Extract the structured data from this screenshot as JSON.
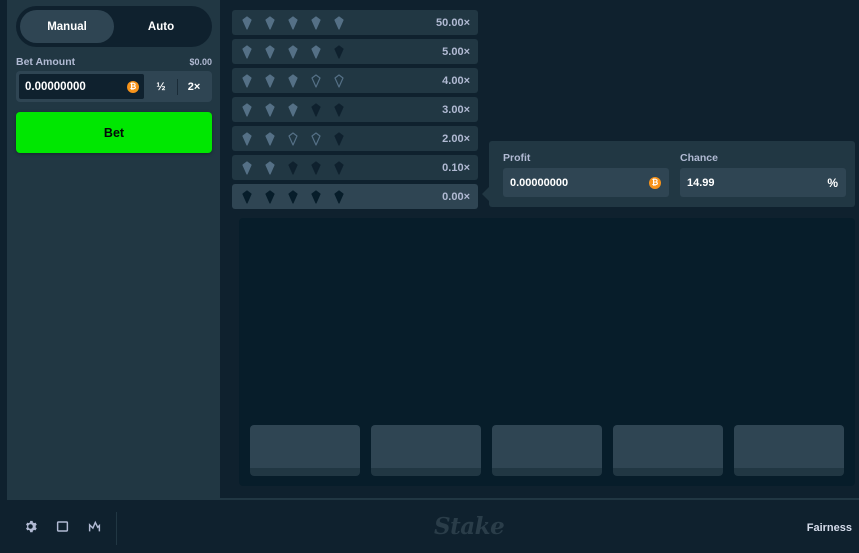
{
  "sidebar": {
    "modes": [
      {
        "label": "Manual",
        "active": true
      },
      {
        "label": "Auto",
        "active": false
      }
    ],
    "bet_amount_label": "Bet Amount",
    "bet_amount_usd": "$0.00",
    "bet_amount_value": "0.00000000",
    "currency_icon": "bitcoin-icon",
    "half_label": "½",
    "double_label": "2×",
    "bet_button_label": "Bet"
  },
  "payout_table": [
    {
      "gems_lit": 5,
      "multiplier": "50.00×",
      "active": false
    },
    {
      "gems_lit": 4,
      "multiplier": "5.00×",
      "active": false
    },
    {
      "gems_lit": 3,
      "multiplier": "4.00×",
      "active": false
    },
    {
      "gems_lit": 3,
      "multiplier": "3.00×",
      "active": false
    },
    {
      "gems_lit": 2,
      "multiplier": "2.00×",
      "active": false
    },
    {
      "gems_lit": 2,
      "multiplier": "0.10×",
      "active": false
    },
    {
      "gems_lit": 0,
      "multiplier": "0.00×",
      "active": true
    }
  ],
  "stats": {
    "profit_label": "Profit",
    "profit_value": "0.00000000",
    "chance_label": "Chance",
    "chance_value": "14.99",
    "chance_unit": "%"
  },
  "board": {
    "tile_count": 5
  },
  "footer": {
    "icons": [
      "gear-icon",
      "theatre-mode-icon",
      "stats-icon"
    ],
    "logo_text": "Stake",
    "fairness_label": "Fairness"
  },
  "colors": {
    "bet_button": "#00e701",
    "panel": "#213743",
    "background": "#0f212e",
    "accent_coin": "#f7931a"
  }
}
